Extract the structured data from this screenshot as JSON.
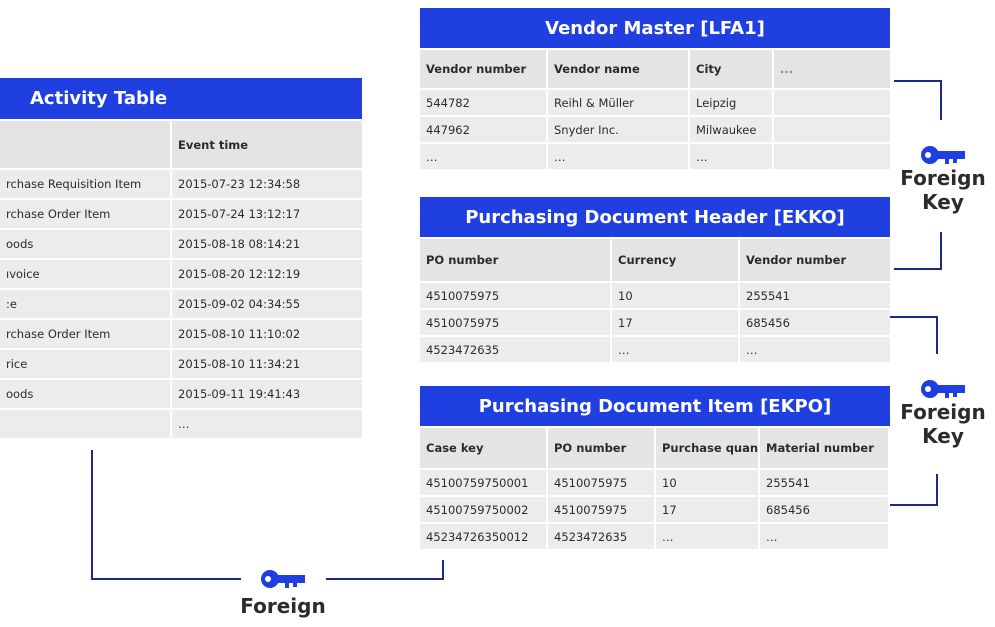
{
  "colors": {
    "header_blue": "#1f3fe0",
    "connector": "#1c2a8a",
    "cell_gray": "#ececec"
  },
  "activity": {
    "title": "Activity Table",
    "headers": [
      "",
      "Event time"
    ],
    "rows": [
      [
        "rchase Requisition Item",
        "2015-07-23 12:34:58"
      ],
      [
        "rchase Order Item",
        "2015-07-24 13:12:17"
      ],
      [
        "oods",
        "2015-08-18 08:14:21"
      ],
      [
        "ıvoice",
        "2015-08-20 12:12:19"
      ],
      [
        ":e",
        "2015-09-02 04:34:55"
      ],
      [
        "rchase Order Item",
        "2015-08-10 11:10:02"
      ],
      [
        "rice",
        "2015-08-10 11:34:21"
      ],
      [
        "oods",
        "2015-09-11 19:41:43"
      ],
      [
        "",
        "…"
      ]
    ]
  },
  "vendor": {
    "title": "Vendor Master [LFA1]",
    "headers": [
      "Vendor number",
      "Vendor name",
      "City",
      "..."
    ],
    "rows": [
      [
        "544782",
        "Reihl & Müller",
        "Leipzig",
        ""
      ],
      [
        "447962",
        "Snyder Inc.",
        "Milwaukee",
        ""
      ],
      [
        "…",
        "…",
        "…",
        ""
      ]
    ]
  },
  "ekko": {
    "title": "Purchasing Document Header [EKKO]",
    "headers": [
      "PO number",
      "Currency",
      "Vendor number"
    ],
    "rows": [
      [
        "4510075975",
        "10",
        "255541"
      ],
      [
        "4510075975",
        "17",
        "685456"
      ],
      [
        "4523472635",
        "…",
        "…"
      ]
    ]
  },
  "ekpo": {
    "title": "Purchasing Document Item [EKPO]",
    "headers": [
      "Case key",
      "PO number",
      "Purchase quantity",
      "Material number"
    ],
    "rows": [
      [
        "45100759750001",
        "4510075975",
        "10",
        "255541"
      ],
      [
        "45100759750002",
        "4510075975",
        "17",
        "685456"
      ],
      [
        "45234726350012",
        "4523472635",
        "…",
        "…"
      ]
    ]
  },
  "labels": {
    "fk_top_line1": "Foreign",
    "fk_top_line2": "Key",
    "fk_mid_line1": "Foreign",
    "fk_mid_line2": "Key",
    "fk_bottom": "Foreign"
  },
  "icons": {
    "key": "key-icon"
  }
}
